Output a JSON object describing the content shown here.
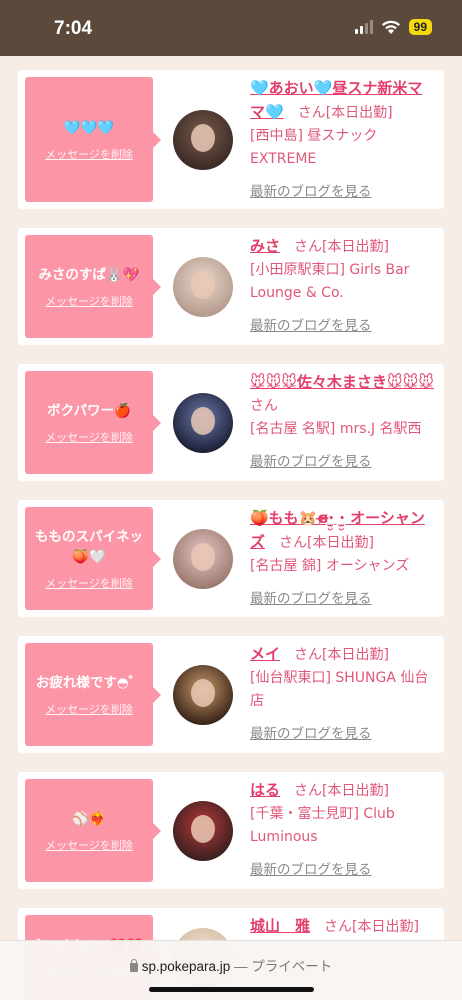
{
  "status": {
    "time": "7:04",
    "battery": "99"
  },
  "colors": {
    "bubble": "#fc95a6",
    "name": "#e43e6b",
    "status_bar": "#5b4a3c"
  },
  "common": {
    "delete_label": "メッセージを削除",
    "blog_label": "最新のブログを見る",
    "san": "さん"
  },
  "cards": [
    {
      "message": "🩵🩵🩵",
      "name": "🩵あおい🩵昼スナ新米ママ🩵",
      "status": "[本日出勤]",
      "shop": "[西中島] 昼スナック EXTREME",
      "avatar_colors": [
        "#3a2a25",
        "#7a5a4c"
      ]
    },
    {
      "message": "みさのすぱ🐰💖",
      "name": "みさ",
      "status": "[本日出勤]",
      "shop": "[小田原駅東口] Girls Bar Lounge & Co.",
      "avatar_colors": [
        "#b59a8c",
        "#e8d8cc"
      ]
    },
    {
      "message": "ボクパワー🍎",
      "name": "🐭🐭🐭佐々木まさき🐭🐭🐭",
      "status": "",
      "shop": "[名古屋 名駅] mrs.J 名駅西",
      "avatar_colors": [
        "#1c2038",
        "#6b78a8"
      ]
    },
    {
      "message": "もものスパイネッ🍑🤍",
      "name": "🍑もも🐹ɞ̴̶̷·̫̮ ·̫̮ オーシャンズ",
      "status": "[本日出勤]",
      "shop": "[名古屋 錦] オーシャンズ",
      "avatar_colors": [
        "#9a7a6c",
        "#e8c4c8"
      ]
    },
    {
      "message": "お疲れ様です◓゜",
      "name": "メイ",
      "status": "[本日出勤]",
      "shop": "[仙台駅東口] SHUNGA 仙台店",
      "avatar_colors": [
        "#3a2418",
        "#c89a6c"
      ]
    },
    {
      "message": "⚾❤️‍🔥",
      "name": "はる",
      "status": "[本日出勤]",
      "shop": "[千葉・富士見町] Club Luminous",
      "avatar_colors": [
        "#3a2020",
        "#b83838"
      ]
    },
    {
      "message": "˚₊*(´ᵕ`)ﾉ*₊❤️❤️",
      "name": "城山　雅",
      "status": "[本日出勤]",
      "shop": "",
      "avatar_colors": [
        "#d4b8a0",
        "#f0e0d0"
      ]
    }
  ],
  "browser": {
    "domain": "sp.pokepara.jp",
    "privacy": "— プライベート"
  }
}
